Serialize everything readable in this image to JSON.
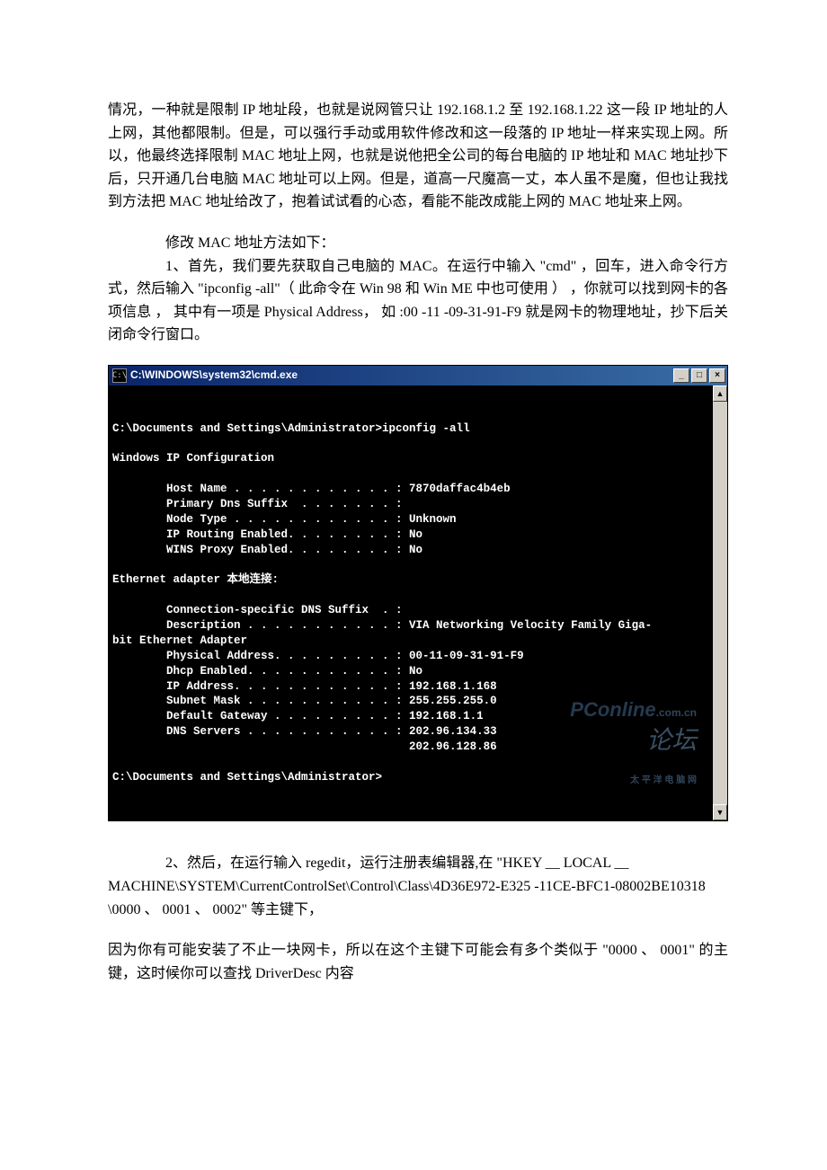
{
  "doc": {
    "para1": "情况，一种就是限制 IP 地址段，也就是说网管只让 192.168.1.2 至 192.168.1.22 这一段 IP 地址的人上网，其他都限制。但是，可以强行手动或用软件修改和这一段落的 IP 地址一样来实现上网。所以，他最终选择限制 MAC 地址上网，也就是说他把全公司的每台电脑的 IP 地址和 MAC 地址抄下后，只开通几台电脑 MAC 地址可以上网。但是，道高一尺魔高一丈，本人虽不是魔，但也让我找到方法把 MAC 地址给改了，抱着试试看的心态，看能不能改成能上网的 MAC 地址来上网。",
    "para2_title": "修改 MAC 地址方法如下：",
    "para2_body": "1、首先，我们要先获取自己电脑的 MAC。在运行中输入  \"cmd\"  ，回车，进入命令行方式，然后输入  \"ipconfig  -all\"（ 此命令在  Win 98  和  Win  ME  中也可使用  ）  ，你就可以找到网卡的各项信息  ，  其中有一项是  Physical  Address，  如  :00  -11  -09-31-91-F9  就是网卡的物理地址，抄下后关闭命令行窗口。",
    "para3": "2、然后，在运行输入 regedit，运行注册表编辑器,在  \"HKEY  __ LOCAL  __ MACHINE\\SYSTEM\\CurrentControlSet\\Control\\Class\\4D36E972-E325 -11CE-BFC1-08002BE10318  \\0000  、  0001  、  0002\"  等主键下，",
    "para4": "因为你有可能安装了不止一块网卡，所以在这个主键下可能会有多个类似于  \"0000  、  0001\"  的主键，这时候你可以查找  DriverDesc  内容"
  },
  "cmd": {
    "title": "C:\\WINDOWS\\system32\\cmd.exe",
    "icon_label": "C:\\",
    "min_label": "_",
    "max_label": "□",
    "close_label": "×",
    "up_arrow": "▲",
    "down_arrow": "▼",
    "output": "\nC:\\Documents and Settings\\Administrator>ipconfig -all\n\nWindows IP Configuration\n\n        Host Name . . . . . . . . . . . . : 7870daffac4b4eb\n        Primary Dns Suffix  . . . . . . . :\n        Node Type . . . . . . . . . . . . : Unknown\n        IP Routing Enabled. . . . . . . . : No\n        WINS Proxy Enabled. . . . . . . . : No\n\nEthernet adapter 本地连接:\n\n        Connection-specific DNS Suffix  . :\n        Description . . . . . . . . . . . : VIA Networking Velocity Family Giga-\nbit Ethernet Adapter\n        Physical Address. . . . . . . . . : 00-11-09-31-91-F9\n        Dhcp Enabled. . . . . . . . . . . : No\n        IP Address. . . . . . . . . . . . : 192.168.1.168\n        Subnet Mask . . . . . . . . . . . : 255.255.255.0\n        Default Gateway . . . . . . . . . : 192.168.1.1\n        DNS Servers . . . . . . . . . . . : 202.96.134.33\n                                            202.96.128.86\n\nC:\\Documents and Settings\\Administrator>",
    "watermark_big": "PConline",
    "watermark_domain": ".com.cn",
    "watermark_cn": "太 平 洋 电 脑 网",
    "watermark_forum": "论坛"
  }
}
